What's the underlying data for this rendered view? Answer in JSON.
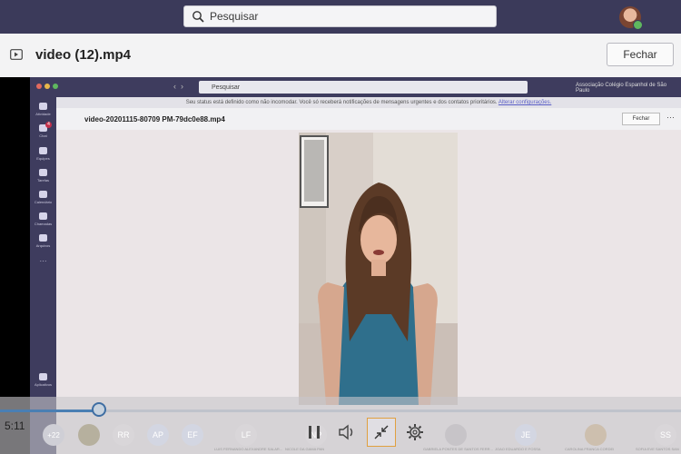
{
  "top_bar": {
    "search_placeholder": "Pesquisar",
    "search_icon": "search-icon"
  },
  "header": {
    "title": "video (12).mp4",
    "file_icon": "video-file-icon",
    "close_label": "Fechar"
  },
  "inner_app": {
    "search_placeholder": "Pesquisar",
    "org_name": "Associação Colégio Espanhol de São Paulo",
    "banner_text": "Seu status está definido como não incomodar. Você só receberá notificações de mensagens urgentes e dos contatos prioritários.",
    "banner_link": "Alterar configurações.",
    "file_title": "video-20201115-80709 PM-79dc0e88.mp4",
    "close_label": "Fechar",
    "more": "···",
    "rail": [
      {
        "label": "Atividade",
        "icon": "bell-icon"
      },
      {
        "label": "Chat",
        "icon": "chat-icon",
        "badge": "4"
      },
      {
        "label": "Equipes",
        "icon": "teams-icon"
      },
      {
        "label": "Tarefas",
        "icon": "tasks-icon"
      },
      {
        "label": "Calendário",
        "icon": "calendar-icon"
      },
      {
        "label": "Chamadas",
        "icon": "phone-icon"
      },
      {
        "label": "Arquivos",
        "icon": "files-icon"
      },
      {
        "label": "···",
        "icon": "more-icon"
      },
      {
        "label": "Aplicativos",
        "icon": "apps-icon"
      }
    ]
  },
  "player": {
    "time": "5:11",
    "progress": 0.145,
    "participants": [
      {
        "initials": "+22"
      },
      {
        "initials": ""
      },
      {
        "initials": "RR"
      },
      {
        "initials": "AP"
      },
      {
        "initials": "EF"
      },
      {
        "initials": "LF",
        "caption": "LUIS FERNANDO ALEXANDRE SALAR..."
      },
      {
        "initials": "NP",
        "caption": "NICOLE DA GAMA PAN"
      },
      {
        "initials": "",
        "caption": "GABRIELA PONTES DE SANTOS FERR..."
      },
      {
        "initials": "JE",
        "caption": "JOAO EDUARDO E FOSSA"
      },
      {
        "initials": "",
        "caption": "CAROLINA FRANCA CORDEI"
      },
      {
        "initials": "SS",
        "caption": "SOFIA EVE SANTOS SAN"
      }
    ],
    "controls": {
      "pause_icon": "pause-icon",
      "volume_icon": "volume-icon",
      "minimize_icon": "minimize-icon",
      "settings_icon": "gear-icon"
    }
  },
  "colors": {
    "top_bar": "#3b3a5a",
    "accent": "#4a7fb3",
    "mini_border": "#e0a040"
  }
}
